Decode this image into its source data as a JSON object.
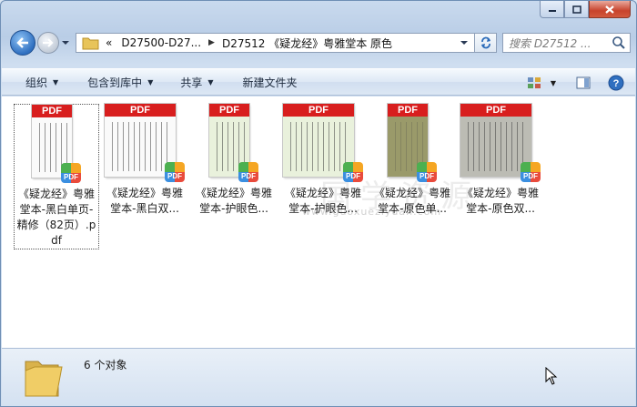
{
  "window": {
    "minimize_label": "Minimize",
    "maximize_label": "Maximize",
    "close_label": "Close"
  },
  "address_bar": {
    "overflow_chevron": "«",
    "crumbs": [
      "D27500-D27...",
      "D27512 《疑龙经》粤雅堂本 原色"
    ]
  },
  "search": {
    "placeholder": "搜索 D27512 ..."
  },
  "toolbar": {
    "organize": "组织",
    "include_in_library": "包含到库中",
    "share": "共享",
    "new_folder": "新建文件夹"
  },
  "files": [
    {
      "badge": "PDF",
      "name": "《疑龙经》粤雅堂本-黑白单页-精修（82页）.pdf",
      "selected": true,
      "tone": "bw"
    },
    {
      "badge": "PDF",
      "name": "《疑龙经》粤雅堂本-黑白双...",
      "selected": false,
      "tone": "bw"
    },
    {
      "badge": "PDF",
      "name": "《疑龙经》粤雅堂本-护眼色...",
      "selected": false,
      "tone": "eye"
    },
    {
      "badge": "PDF",
      "name": "《疑龙经》粤雅堂本-护眼色...",
      "selected": false,
      "tone": "eye"
    },
    {
      "badge": "PDF",
      "name": "《疑龙经》粤雅堂本-原色单...",
      "selected": false,
      "tone": "orig"
    },
    {
      "badge": "PDF",
      "name": "《疑龙经》粤雅堂本-原色双...",
      "selected": false,
      "tone": "orig2"
    }
  ],
  "watermark": {
    "text": "www.guoxueziyuan.com"
  },
  "status": {
    "count": "6 个对象"
  },
  "colors": {
    "pdf_red": "#d81e1e",
    "window_frame": "#c9daee"
  }
}
